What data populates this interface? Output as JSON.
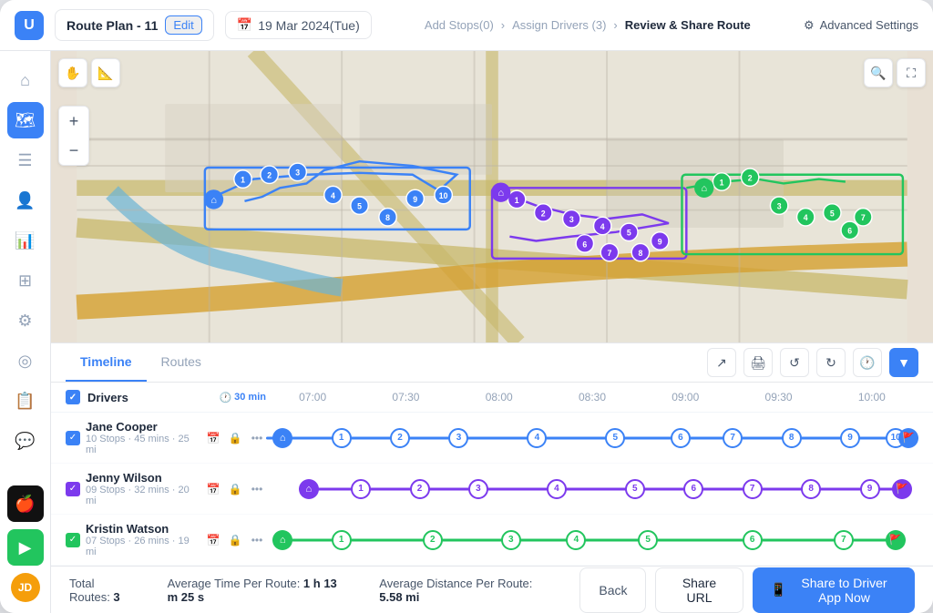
{
  "header": {
    "route_plan_label": "Route Plan - 11",
    "edit_label": "Edit",
    "date_label": "19 Mar 2024(Tue)",
    "breadcrumb": [
      {
        "label": "Add Stops(0)",
        "active": false
      },
      {
        "label": "Assign Drivers (3)",
        "active": false
      },
      {
        "label": "Review & Share Route",
        "active": true
      }
    ],
    "advanced_settings": "Advanced Settings"
  },
  "sidebar": {
    "icons": [
      {
        "name": "home-icon",
        "symbol": "⌂",
        "active": false
      },
      {
        "name": "map-icon",
        "symbol": "🗺",
        "active": true
      },
      {
        "name": "list-icon",
        "symbol": "☰",
        "active": false
      },
      {
        "name": "user-icon",
        "symbol": "👤",
        "active": false
      },
      {
        "name": "chart-icon",
        "symbol": "📊",
        "active": false
      },
      {
        "name": "grid-icon",
        "symbol": "⊞",
        "active": false
      },
      {
        "name": "settings-icon",
        "symbol": "⚙",
        "active": false
      },
      {
        "name": "location-icon",
        "symbol": "◎",
        "active": false
      },
      {
        "name": "report-icon",
        "symbol": "📋",
        "active": false
      },
      {
        "name": "message-icon",
        "symbol": "💬",
        "active": false
      }
    ],
    "bottom": [
      {
        "name": "apple-icon",
        "symbol": "🍎"
      },
      {
        "name": "android-icon",
        "symbol": "▶"
      }
    ]
  },
  "tabs": [
    {
      "id": "timeline",
      "label": "Timeline",
      "active": true
    },
    {
      "id": "routes",
      "label": "Routes",
      "active": false
    }
  ],
  "timeline": {
    "driver_col_label": "Drivers",
    "duration_label": "30 min",
    "time_slots": [
      "07:00",
      "07:30",
      "08:00",
      "08:30",
      "09:00",
      "09:30",
      "10:00"
    ],
    "drivers": [
      {
        "name": "Jane Cooper",
        "stats": "10 Stops · 45 mins · 25 mi",
        "color": "#3b82f6",
        "stops": [
          1,
          2,
          3,
          4,
          5,
          6,
          7,
          8,
          9,
          10
        ],
        "checked": true
      },
      {
        "name": "Jenny Wilson",
        "stats": "09 Stops · 32 mins · 20 mi",
        "color": "#7c3aed",
        "stops": [
          1,
          2,
          3,
          4,
          5,
          6,
          7,
          8,
          9
        ],
        "checked": true
      },
      {
        "name": "Kristin Watson",
        "stats": "07 Stops · 26 mins · 19 mi",
        "color": "#22c55e",
        "stops": [
          1,
          2,
          3,
          4,
          5,
          6,
          7
        ],
        "checked": true
      }
    ]
  },
  "status_bar": {
    "total_routes_label": "Total Routes:",
    "total_routes_value": "3",
    "avg_time_label": "Average Time Per Route:",
    "avg_time_value": "1 h 13 m 25 s",
    "avg_dist_label": "Average Distance Per Route:",
    "avg_dist_value": "5.58 mi",
    "back_label": "Back",
    "share_url_label": "Share URL",
    "share_driver_label": "Share to Driver App Now"
  }
}
